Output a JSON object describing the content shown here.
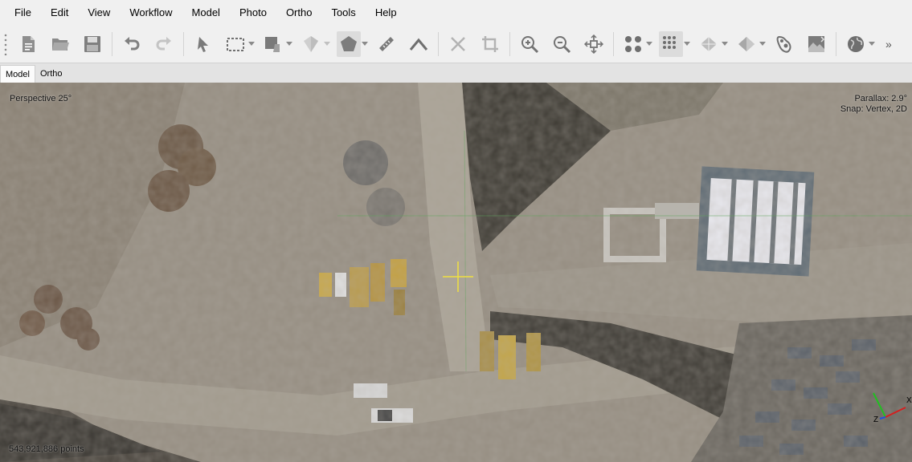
{
  "menu": {
    "items": [
      "File",
      "Edit",
      "View",
      "Workflow",
      "Model",
      "Photo",
      "Ortho",
      "Tools",
      "Help"
    ]
  },
  "toolbar": {
    "icons": [
      "new-document-icon",
      "open-folder-icon",
      "save-icon",
      "undo-icon",
      "redo-icon",
      "navigation-pointer-icon",
      "rectangle-selection-icon",
      "draw-shape-icon",
      "3d-shape-icon",
      "polygon-icon",
      "ruler-icon",
      "angle-icon",
      "delete-selection-icon",
      "crop-icon",
      "zoom-in-icon",
      "zoom-out-icon",
      "reset-view-icon",
      "point-cloud-icon",
      "dense-cloud-icon",
      "mesh-icon",
      "textured-mesh-icon",
      "tiled-model-icon",
      "dem-icon",
      "globe-icon"
    ],
    "overflow_label": "»"
  },
  "tabs": [
    {
      "label": "Model",
      "active": true
    },
    {
      "label": "Ortho",
      "active": false
    }
  ],
  "viewport": {
    "perspective": "Perspective 25°",
    "parallax": "Parallax: 2.9°",
    "snap": "Snap: Vertex, 2D",
    "points": "543,921,886 points",
    "axis_labels": {
      "x": "X",
      "z": "Z"
    }
  },
  "colors": {
    "chrome": "#f0f0f0",
    "ground": "#948c80",
    "axis_x": "#d42020",
    "axis_y": "#20c020",
    "axis_z": "#2050e0",
    "crosshair": "#f0e040"
  }
}
